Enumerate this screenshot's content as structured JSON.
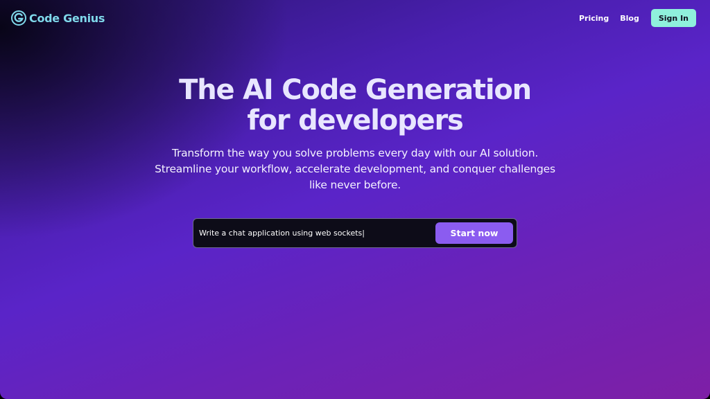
{
  "brand": {
    "name": "Code Genius",
    "logo_icon": "letter-g-logo-icon",
    "color": "#7fd8ea"
  },
  "nav": {
    "links": [
      {
        "label": "Pricing"
      },
      {
        "label": "Blog"
      }
    ],
    "signin_label": "Sign In"
  },
  "hero": {
    "title_line1": "The AI Code Generation",
    "title_line2": "for developers",
    "subtitle": "Transform the way you solve problems every day with our AI solution. Streamline your workflow, accelerate development, and conquer challenges like never before."
  },
  "prompt": {
    "value": "Write a chat application using web sockets|",
    "button_label": "Start now"
  },
  "colors": {
    "accent_button": "#8b5cf0",
    "signin_bg": "#8ff0dc",
    "title": "#e8e6ff"
  }
}
